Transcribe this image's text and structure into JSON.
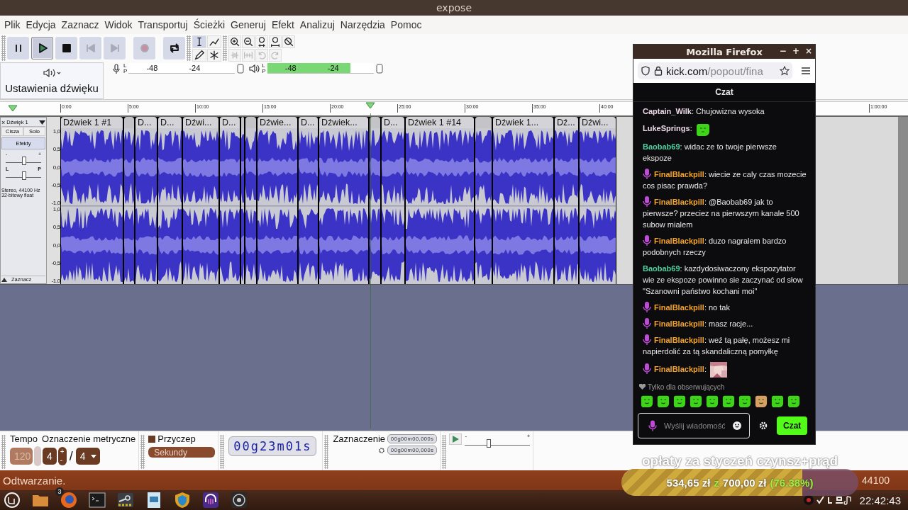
{
  "window": {
    "title": "expose"
  },
  "menu": [
    "Plik",
    "Edycja",
    "Zaznacz",
    "Widok",
    "Transportuj",
    "Ścieżki",
    "Generuj",
    "Efekt",
    "Analizuj",
    "Narzędzia",
    "Pomoc"
  ],
  "transport": [
    {
      "kind": "pause",
      "pressed": false,
      "disabled": false
    },
    {
      "kind": "play",
      "pressed": true,
      "disabled": false
    },
    {
      "kind": "stop",
      "pressed": false,
      "disabled": false
    },
    {
      "kind": "skip-start",
      "pressed": false,
      "disabled": true
    },
    {
      "kind": "skip-end",
      "pressed": false,
      "disabled": true
    },
    {
      "kind": "record",
      "pressed": false,
      "disabled": true
    },
    {
      "kind": "loop",
      "pressed": false,
      "disabled": false
    }
  ],
  "tools": [
    {
      "kind": "select",
      "selected": true
    },
    {
      "kind": "envelope",
      "selected": false
    },
    {
      "kind": "draw",
      "selected": false
    },
    {
      "kind": "multi",
      "selected": false
    }
  ],
  "edit_tools": [
    {
      "kind": "zoom-in",
      "disabled": false
    },
    {
      "kind": "zoom-out",
      "disabled": false
    },
    {
      "kind": "fit-selection",
      "disabled": false
    },
    {
      "kind": "fit-project",
      "disabled": false
    },
    {
      "kind": "zoom-toggle",
      "disabled": false
    },
    {
      "kind": "trim",
      "disabled": true
    },
    {
      "kind": "silence",
      "disabled": true
    },
    {
      "kind": "undo",
      "disabled": true
    },
    {
      "kind": "redo",
      "disabled": true
    }
  ],
  "audio_setup": {
    "label": "Ustawienia dźwięku"
  },
  "meters": [
    {
      "kind": "record",
      "channels": [
        "L",
        "P"
      ],
      "ticks": [
        "-48",
        "-24"
      ]
    },
    {
      "kind": "playback",
      "channels": [
        "L",
        "P"
      ],
      "ticks": [
        "-48",
        "-24"
      ],
      "level": 0.78
    }
  ],
  "ruler": {
    "ticks": [
      "0:00",
      "5:00",
      "10:00",
      "15:00",
      "20:00",
      "25:00",
      "30:00",
      "35:00",
      "40:00"
    ],
    "tick_right": "1:00:00"
  },
  "track": {
    "close": "×",
    "name": "Dźwięk 1",
    "buttons": [
      "Cisza",
      "Solo"
    ],
    "effects": "Efekty",
    "gain": {
      "minus": "-",
      "plus": "+",
      "level": 0.5
    },
    "pan": {
      "left": "L",
      "right": "P",
      "level": 0.5
    },
    "info": [
      "Stereo, 44100 Hz",
      "32-bitowy float"
    ],
    "select": "Zaznacz",
    "channels": [
      {
        "scale": [
          "1,0",
          "0,5",
          "0,0",
          "-0,5",
          "-1,0"
        ]
      },
      {
        "scale": [
          "1,0",
          "0,5",
          "0,0",
          "-0,5",
          "-1,0"
        ]
      }
    ],
    "clips": [
      {
        "kind": "titled",
        "label": "Dźwiek 1 #1"
      },
      {
        "kind": "untitled"
      },
      {
        "kind": "titled",
        "label": "D..."
      },
      {
        "kind": "titled",
        "label": "D..."
      },
      {
        "kind": "titled",
        "label": "Dźwi..."
      },
      {
        "kind": "titled",
        "label": "D..."
      },
      {
        "kind": "untitled"
      },
      {
        "kind": "untitled"
      },
      {
        "kind": "titled",
        "label": "Dźwie..."
      },
      {
        "kind": "titled",
        "label": "D..."
      },
      {
        "kind": "titled",
        "label": "Dźwiek..."
      },
      {
        "kind": "untitled"
      },
      {
        "kind": "titled",
        "label": "D..."
      },
      {
        "kind": "titled",
        "label": "Dźwiek 1 #14"
      },
      {
        "kind": "untitled"
      },
      {
        "kind": "titled",
        "label": "Dźwiek 1..."
      },
      {
        "kind": "titled",
        "label": "Dź..."
      },
      {
        "kind": "titled",
        "label": "Dźwi..."
      }
    ]
  },
  "bottom": {
    "tempo": {
      "label": "Tempo",
      "value": "120"
    },
    "time_signature": {
      "label": "Oznaczenie metryczne",
      "upper": "4",
      "plus": "+",
      "minus": "-",
      "separator": "/",
      "lower": "4"
    },
    "snap": {
      "label": "Przyczep",
      "checked": false,
      "unit": "Sekundy"
    },
    "time": "00g23m01s",
    "selection": {
      "label": "Zaznaczenie",
      "start": "00g00m00,000s",
      "end": "00g00m00,000s"
    },
    "speed": {
      "minus": "-",
      "plus": "+",
      "level": 0.35
    }
  },
  "status_bar": {
    "text": "Odtwarzanie.",
    "rate": "44100"
  },
  "taskbar": {
    "apps": [
      {
        "kind": "menu"
      },
      {
        "kind": "folder"
      },
      {
        "kind": "firefox",
        "badge": "3"
      },
      {
        "kind": "terminal"
      },
      {
        "kind": "steam"
      },
      {
        "kind": "document"
      },
      {
        "kind": "shield"
      },
      {
        "kind": "headphones"
      },
      {
        "kind": "obs"
      }
    ],
    "clock": "22:42:43"
  },
  "firefox": {
    "title": "Mozilla Firefox",
    "controls": [
      "−",
      "+",
      "×"
    ],
    "url_host": "kick.com",
    "url_path": "/popout/fina",
    "chat": {
      "title": "Czat",
      "messages": [
        {
          "user": "Captain_Wilk",
          "separator": ":",
          "color": "#ecd9e6",
          "badge": false,
          "kind": "text",
          "text": "Chujowizna wysoka"
        },
        {
          "user": "LukeSprings",
          "separator": ":",
          "color": "#ecd9e6",
          "badge": false,
          "kind": "emote"
        },
        {
          "user": "Baobab69",
          "separator": ":",
          "color": "#4fd1a0",
          "badge": false,
          "kind": "text",
          "text": "widac ze to twoje pierwsze ekspoze"
        },
        {
          "user": "FinalBlackpill",
          "separator": ":",
          "color": "#f3a42c",
          "badge": true,
          "kind": "text",
          "text": "wiecie ze caly czas mozecie cos pisac prawda?"
        },
        {
          "user": "FinalBlackpill",
          "separator": ":",
          "color": "#f3a42c",
          "badge": true,
          "kind": "text",
          "text": "@Baobab69 jak to pierwsze? przeciez na pierwszym kanale 500 subow mialem"
        },
        {
          "user": "FinalBlackpill",
          "separator": ":",
          "color": "#f3a42c",
          "badge": true,
          "kind": "text",
          "text": "duzo nagralem bardzo podobnych rzeczy"
        },
        {
          "user": "Baobab69",
          "separator": ":",
          "color": "#4fd1a0",
          "badge": false,
          "kind": "text",
          "text": "kazdydosiwaczony ekspozytator wie ze ekspoze powinno sie zaczynać od słow \"Szanowni państwo kochani moi\""
        },
        {
          "user": "FinalBlackpill",
          "separator": ":",
          "color": "#f3a42c",
          "badge": true,
          "kind": "text",
          "text": "no tak"
        },
        {
          "user": "FinalBlackpill",
          "separator": ":",
          "color": "#f3a42c",
          "badge": true,
          "kind": "text",
          "text": "masz racje..."
        },
        {
          "user": "FinalBlackpill",
          "separator": ":",
          "color": "#f3a42c",
          "badge": true,
          "kind": "text",
          "text": "weź tą pałę, możesz mi napierdolić za tą skandaliczną pomyłkę"
        },
        {
          "user": "FinalBlackpill",
          "separator": ":",
          "color": "#f3a42c",
          "badge": true,
          "kind": "picture"
        }
      ],
      "followers_only": "Tylko dla obserwujących",
      "placeholder": "Wyślij wiadomość",
      "send": "Czat"
    }
  },
  "goal_overlay": {
    "title": "opłaty za styczeń czynsz+prąd",
    "amount": "534,65 zł",
    "separator": "z",
    "target": "700,00 zł",
    "percent": "(76.38%)",
    "level": 0.7638
  }
}
